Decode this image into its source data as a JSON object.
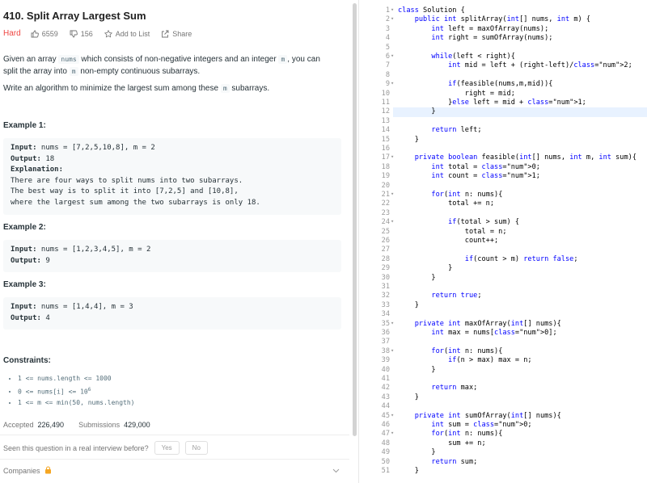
{
  "problem": {
    "title": "410. Split Array Largest Sum",
    "difficulty": "Hard",
    "likes": "6559",
    "dislikes": "156",
    "add_to_list": "Add to List",
    "share": "Share",
    "colors": {
      "hard": "#ef4743",
      "accent": "#2196f3"
    }
  },
  "description": {
    "p1_a": "Given an array ",
    "p1_code1": "nums",
    "p1_b": " which consists of non-negative integers and an integer ",
    "p1_code2": "m",
    "p1_c": ", you can split the array into ",
    "p1_code3": "m",
    "p1_d": " non-empty continuous subarrays.",
    "p2_a": "Write an algorithm to minimize the largest sum among these ",
    "p2_code": "m",
    "p2_b": " subarrays."
  },
  "examples": [
    {
      "heading": "Example 1:",
      "input_label": "Input:",
      "input": " nums = [7,2,5,10,8], m = 2",
      "output_label": "Output:",
      "output": " 18",
      "explanation_label": "Explanation:",
      "explanation": [
        "There are four ways to split nums into two subarrays.",
        "The best way is to split it into [7,2,5] and [10,8],",
        "where the largest sum among the two subarrays is only 18."
      ]
    },
    {
      "heading": "Example 2:",
      "input_label": "Input:",
      "input": " nums = [1,2,3,4,5], m = 2",
      "output_label": "Output:",
      "output": " 9"
    },
    {
      "heading": "Example 3:",
      "input_label": "Input:",
      "input": " nums = [1,4,4], m = 3",
      "output_label": "Output:",
      "output": " 4"
    }
  ],
  "constraints": {
    "heading": "Constraints:",
    "items": [
      "1 <= nums.length <= 1000",
      "0 <= nums[i] <= 10",
      "1 <= m <= min(50, nums.length)"
    ],
    "sup": "6"
  },
  "stats": {
    "accepted_label": "Accepted",
    "accepted": "226,490",
    "submissions_label": "Submissions",
    "submissions": "429,000"
  },
  "interview": {
    "question": "Seen this question in a real interview before?",
    "yes": "Yes",
    "no": "No"
  },
  "companies": {
    "label": "Companies"
  },
  "editor": {
    "highlighted_line": 12,
    "fold_lines": [
      1,
      2,
      6,
      9,
      17,
      21,
      24,
      35,
      38,
      45,
      47
    ],
    "lines": [
      "class Solution {",
      "    public int splitArray(int[] nums, int m) {",
      "        int left = maxOfArray(nums);",
      "        int right = sumOfArray(nums);",
      "",
      "        while(left < right){",
      "            int mid = left + (right-left)/2;",
      "",
      "            if(feasible(nums,m,mid)){",
      "                right = mid;",
      "            }else left = mid + 1;",
      "        }",
      "",
      "        return left;",
      "    }",
      "",
      "    private boolean feasible(int[] nums, int m, int sum){",
      "        int total = 0;",
      "        int count = 1;",
      "",
      "        for(int n: nums){",
      "            total += n;",
      "",
      "            if(total > sum) {",
      "                total = n;",
      "                count++;",
      "",
      "                if(count > m) return false;",
      "            }",
      "        }",
      "",
      "        return true;",
      "    }",
      "",
      "    private int maxOfArray(int[] nums){",
      "        int max = nums[0];",
      "",
      "        for(int n: nums){",
      "            if(n > max) max = n;",
      "        }",
      "",
      "        return max;",
      "    }",
      "",
      "    private int sumOfArray(int[] nums){",
      "        int sum = 0;",
      "        for(int n: nums){",
      "            sum += n;",
      "        }",
      "        return sum;",
      "    }"
    ]
  }
}
